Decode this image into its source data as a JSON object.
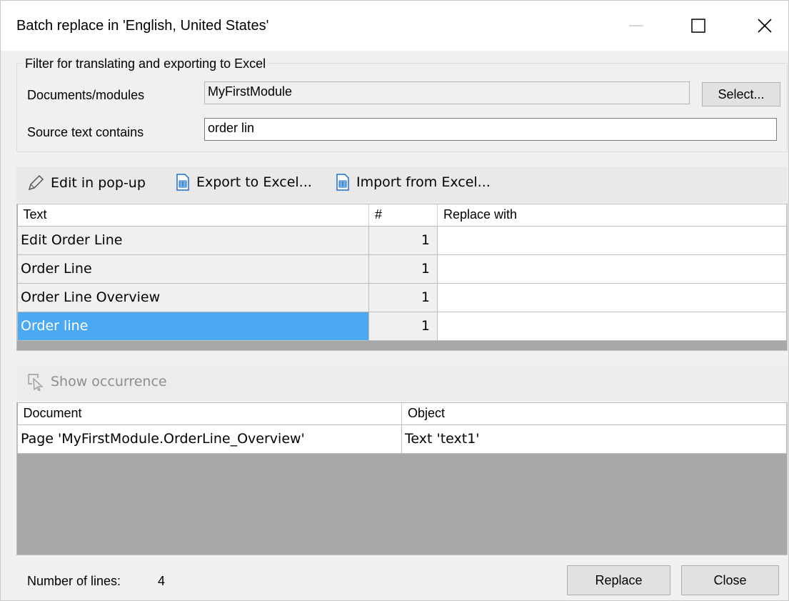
{
  "window": {
    "title": "Batch replace in 'English, United States'",
    "controls": [
      "minimize-icon",
      "maximize-icon",
      "close-icon"
    ]
  },
  "filter": {
    "legend": "Filter for translating and exporting to Excel",
    "documents_label": "Documents/modules",
    "documents_value": "MyFirstModule",
    "select_button": "Select...",
    "source_label": "Source text contains",
    "source_value": "order lin"
  },
  "toolbar": {
    "edit_popup": "Edit in pop-up",
    "export_excel": "Export to Excel...",
    "import_excel": "Import from Excel..."
  },
  "texts_grid": {
    "columns": [
      "Text",
      "#",
      "Replace with"
    ],
    "rows": [
      {
        "text": "Edit Order Line",
        "count": "1",
        "replace": ""
      },
      {
        "text": "Order Line",
        "count": "1",
        "replace": ""
      },
      {
        "text": "Order Line Overview",
        "count": "1",
        "replace": ""
      },
      {
        "text": "Order line",
        "count": "1",
        "replace": ""
      }
    ],
    "selected_row": 3
  },
  "occurrence_toolbar": {
    "show_occurrence": "Show occurrence"
  },
  "occurrence_grid": {
    "columns": [
      "Document",
      "Object"
    ],
    "rows": [
      {
        "document": "Page 'MyFirstModule.OrderLine_Overview'",
        "object": "Text 'text1'"
      }
    ]
  },
  "footer": {
    "lines_label": "Number of lines:",
    "lines_value": "4",
    "replace_button": "Replace",
    "close_button": "Close"
  },
  "colors": {
    "selection": "#4aa9f0",
    "window_bg": "#f0f0f0",
    "grid_empty": "#a8a8a8"
  }
}
